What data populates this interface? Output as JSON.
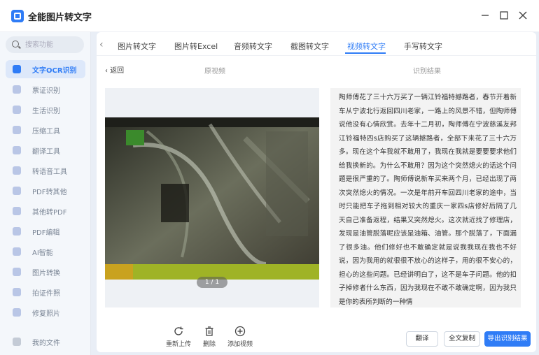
{
  "app": {
    "title": "全能图片转文字"
  },
  "search": {
    "placeholder": "搜索功能"
  },
  "sidebar": {
    "items": [
      {
        "label": "文字OCR识别",
        "active": true
      },
      {
        "label": "票证识别"
      },
      {
        "label": "生活识别"
      },
      {
        "label": "压缩工具"
      },
      {
        "label": "翻译工具"
      },
      {
        "label": "转语音工具"
      },
      {
        "label": "PDF转其他"
      },
      {
        "label": "其他转PDF"
      },
      {
        "label": "PDF编辑"
      },
      {
        "label": "AI智能"
      },
      {
        "label": "图片转换"
      },
      {
        "label": "拍证件照"
      },
      {
        "label": "修复照片"
      }
    ],
    "my_files": "我的文件"
  },
  "tabs": [
    {
      "label": "图片转文字"
    },
    {
      "label": "图片转Excel"
    },
    {
      "label": "音频转文字"
    },
    {
      "label": "截图转文字"
    },
    {
      "label": "视频转文字",
      "active": true
    },
    {
      "label": "手写转文字"
    }
  ],
  "subbar": {
    "back": "返回",
    "left_title": "原视频",
    "right_title": "识别结果"
  },
  "video": {
    "page_indicator": "1 / 1"
  },
  "result": {
    "text": "陶师傅花了三十六万买了一辆江铃福特撼路者，春节开着新车从宁波北行返回四川老家，一路上的风景不错，但陶师傅说他没有心情欣赏。去年十二月初，陶师傅在宁波慈溪友邦江铃福特四s店购买了这辆撼路者，全部下来花了三十六万多。现在这个车我就不敢用了，我现在我就是要要要求他们给我换新的。为什么不敢用？因为这个突然熄火的话这个问题是很严重的了。陶师傅说新车买来两个月，已经出现了两次突然熄火的情况。一次是年前开车回四川老家的途中，当时只能把车子拖到相对较大的重庆一家四s店修好后隔了几天自己准备返程，结果又突然熄火。这次就近找了修理店，发现是油管脱落呢应该是油箱、油管。那个脱落了，下面漏了很多油。他们修好也不敢确定就是说我我现在我也不好说，因为我用的就很很不放心的这样子，用的很不安心的，担心的这些问题。已经讲明白了，这不是车子问题。他的扣子掉修者什么东西，因为我现在不敢不敢确定啊，因为我只是你的表所判断的一种情"
  },
  "tools": {
    "reupload": "重新上传",
    "delete": "删除",
    "add_video": "添加视频"
  },
  "buttons": {
    "translate": "翻译",
    "copy_all": "全文复制",
    "export": "导出识别结果"
  },
  "colors": {
    "accent": "#2f7cf6"
  }
}
